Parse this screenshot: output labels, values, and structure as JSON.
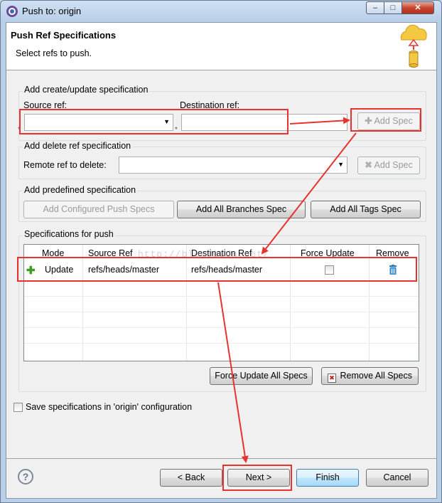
{
  "window": {
    "title": "Push to: origin",
    "controls": {
      "minimize": "–",
      "maximize": "□",
      "close": "✕"
    }
  },
  "header": {
    "title": "Push Ref Specifications",
    "subtitle": "Select refs to push."
  },
  "create_group": {
    "label": "Add create/update specification",
    "source_label": "Source ref:",
    "destination_label": "Destination ref:",
    "source_value": "",
    "destination_value": "",
    "required_marker": "*",
    "add_spec": "Add Spec"
  },
  "delete_group": {
    "label": "Add delete ref specification",
    "remote_label": "Remote ref to delete:",
    "remote_value": "",
    "add_spec": "Add Spec"
  },
  "predefined_group": {
    "label": "Add predefined specification",
    "configured": "Add Configured Push Specs",
    "all_branches": "Add All Branches Spec",
    "all_tags": "Add All Tags Spec"
  },
  "specs_group": {
    "label": "Specifications for push",
    "columns": [
      "Mode",
      "Source Ref",
      "Destination Ref",
      "Force Update",
      "Remove"
    ],
    "rows": [
      {
        "mode": "Update",
        "source": "refs/heads/master",
        "destination": "refs/heads/master",
        "force": false
      }
    ],
    "watermark": "http://blog.csdn.net/",
    "force_all": "Force Update All Specs",
    "remove_all": "Remove All Specs"
  },
  "save_config": {
    "label": "Save specifications in 'origin' configuration",
    "checked": false
  },
  "footer": {
    "help": "?",
    "back": "< Back",
    "next": "Next >",
    "finish": "Finish",
    "cancel": "Cancel"
  },
  "colors": {
    "annotation_red": "#e8322f",
    "accent_blue": "#3c7fb1",
    "add_green": "#3ba021",
    "trash_blue": "#2f7fc0",
    "cloud_gold": "#f5c842"
  }
}
